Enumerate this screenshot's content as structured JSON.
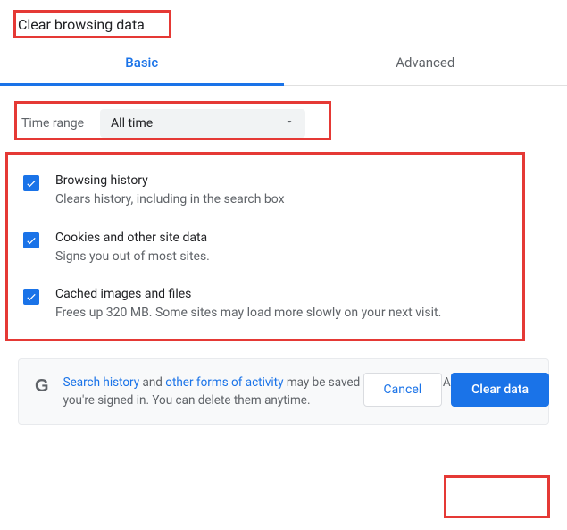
{
  "title": "Clear browsing data",
  "tabs": {
    "basic": "Basic",
    "advanced": "Advanced"
  },
  "timerange": {
    "label": "Time range",
    "value": "All time"
  },
  "items": [
    {
      "title": "Browsing history",
      "desc": "Clears history, including in the search box"
    },
    {
      "title": "Cookies and other site data",
      "desc": "Signs you out of most sites."
    },
    {
      "title": "Cached images and files",
      "desc": "Frees up 320 MB. Some sites may load more slowly on your next visit."
    }
  ],
  "notice": {
    "link1": "Search history",
    "mid1": " and ",
    "link2": "other forms of activity",
    "rest": " may be saved in your Google Account when you're signed in. You can delete them anytime."
  },
  "buttons": {
    "cancel": "Cancel",
    "clear": "Clear data"
  },
  "glyphs": {
    "google": "G"
  }
}
